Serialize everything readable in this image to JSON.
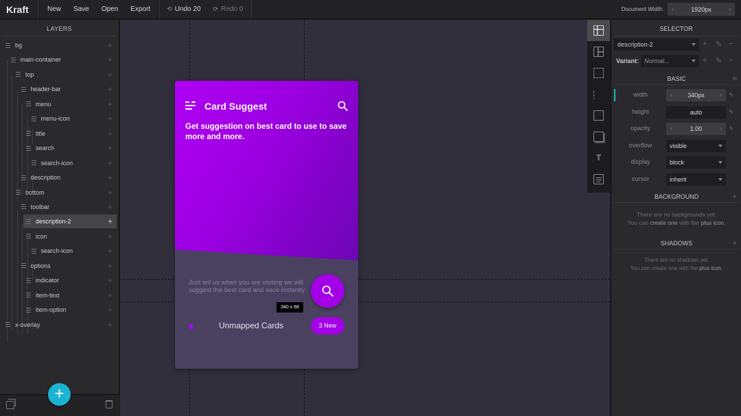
{
  "app": {
    "brand": "Kraft"
  },
  "toolbar": {
    "new_label": "New",
    "save_label": "Save",
    "open_label": "Open",
    "export_label": "Export",
    "undo_label": "Undo 20",
    "redo_label": "Redo 0",
    "doc_width_label": "Document Width:",
    "doc_width_value": "1920px"
  },
  "layers": {
    "title": "LAYERS",
    "items": [
      {
        "label": "bg",
        "depth": 0
      },
      {
        "label": "main-container",
        "depth": 1
      },
      {
        "label": "top",
        "depth": 2
      },
      {
        "label": "header-bar",
        "depth": 3
      },
      {
        "label": "menu",
        "depth": 4
      },
      {
        "label": "menu-icon",
        "depth": 5
      },
      {
        "label": "title",
        "depth": 4
      },
      {
        "label": "search",
        "depth": 4
      },
      {
        "label": "search-icon",
        "depth": 5
      },
      {
        "label": "description",
        "depth": 3
      },
      {
        "label": "bottom",
        "depth": 2
      },
      {
        "label": "toolbar",
        "depth": 3
      },
      {
        "label": "description-2",
        "depth": 4,
        "selected": true
      },
      {
        "label": "icon",
        "depth": 4
      },
      {
        "label": "search-icon",
        "depth": 5
      },
      {
        "label": "options",
        "depth": 3
      },
      {
        "label": "indicator",
        "depth": 4
      },
      {
        "label": "item-text",
        "depth": 4
      },
      {
        "label": "item-option",
        "depth": 4
      },
      {
        "label": "x-overlay",
        "depth": 0
      }
    ]
  },
  "card": {
    "title": "Card Suggest",
    "description": "Get suggestion on best card to use to save more and more.",
    "description_2": "Just tell us when you are visiting we will suggest the best card and sace instantly",
    "item_text": "Unmapped Cards",
    "badge": "3 New",
    "size_tooltip": "340 x 68",
    "gradient_start": "#b000f5",
    "gradient_end": "#6c06b3",
    "accent": "#a400e8"
  },
  "selector": {
    "title": "SELECTOR",
    "value": "description-2",
    "variant_label": "Variant:",
    "variant_value": "Normal..."
  },
  "basic": {
    "title": "BASIC",
    "props": [
      {
        "label": "width",
        "value": "340px",
        "kind": "stepper"
      },
      {
        "label": "height",
        "value": "auto",
        "kind": "text"
      },
      {
        "label": "opacity",
        "value": "1.00",
        "kind": "stepper"
      },
      {
        "label": "overflow",
        "value": "visible",
        "kind": "select"
      },
      {
        "label": "display",
        "value": "block",
        "kind": "select"
      },
      {
        "label": "cursor",
        "value": "inherit",
        "kind": "select"
      }
    ]
  },
  "background": {
    "title": "BACKGROUND",
    "empty_line1": "There are no backgrounds yet.",
    "empty_line2_a": "You can ",
    "empty_line2_b": "create one",
    "empty_line2_c": " with the ",
    "empty_line2_d": "plus icon",
    "empty_line2_e": "."
  },
  "shadows": {
    "title": "SHADOWS",
    "empty_line1": "There are no shadows yet.",
    "empty_line2_a": "You can create one with the ",
    "empty_line2_b": "plus icon",
    "empty_line2_c": "."
  },
  "colors": {
    "accent_cyan": "#1bb3d4",
    "purple": "#a400e8"
  }
}
